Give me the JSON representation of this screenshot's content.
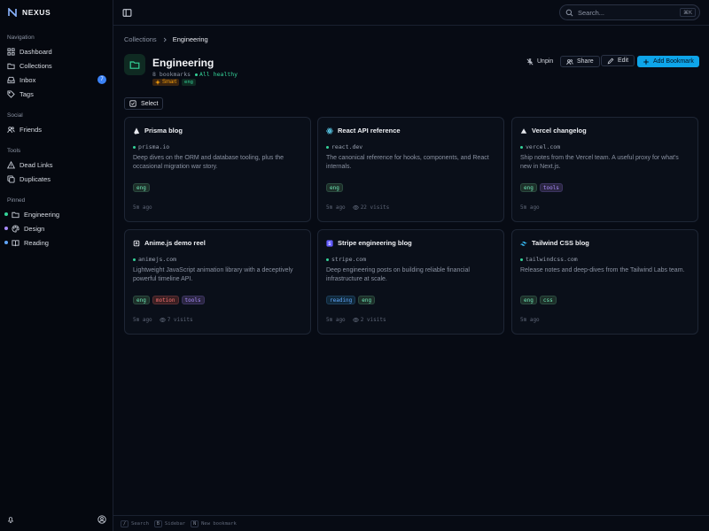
{
  "brand": {
    "name": "NEXUS"
  },
  "sidebar": {
    "sections": [
      {
        "label": "Navigation"
      },
      {
        "label": "Social"
      },
      {
        "label": "Tools"
      },
      {
        "label": "Pinned"
      }
    ],
    "navigation": [
      {
        "label": "Dashboard",
        "icon": "grid-icon"
      },
      {
        "label": "Collections",
        "icon": "folder-icon"
      },
      {
        "label": "Inbox",
        "icon": "inbox-icon",
        "badge": "7"
      },
      {
        "label": "Tags",
        "icon": "tag-icon"
      }
    ],
    "social": [
      {
        "label": "Friends",
        "icon": "users-icon"
      }
    ],
    "tools": [
      {
        "label": "Dead Links",
        "icon": "warning-icon"
      },
      {
        "label": "Duplicates",
        "icon": "copy-icon"
      }
    ],
    "pinned": [
      {
        "label": "Engineering",
        "icon": "folder-icon",
        "dot_color": "#34d399"
      },
      {
        "label": "Design",
        "icon": "palette-icon",
        "dot_color": "#a78bfa"
      },
      {
        "label": "Reading",
        "icon": "book-icon",
        "dot_color": "#60a5fa"
      }
    ]
  },
  "topbar": {
    "search_placeholder": "Search...",
    "search_shortcut": "⌘K"
  },
  "breadcrumb": {
    "parent": "Collections",
    "current": "Engineering"
  },
  "collection": {
    "title": "Engineering",
    "count": "8 bookmarks",
    "health": "All healthy",
    "smart_chip": "Smart",
    "tag_chip": "eng"
  },
  "actions": {
    "unpin": "Unpin",
    "share": "Share",
    "edit": "Edit",
    "add": "Add Bookmark"
  },
  "select_label": "Select",
  "cards": [
    {
      "title": "Prisma blog",
      "icon": "prisma-icon",
      "domain": "prisma.io",
      "desc": "Deep dives on the ORM and database tooling, plus the occasional migration war story.",
      "tags": [
        "eng"
      ],
      "time": "5m ago",
      "visits": ""
    },
    {
      "title": "React API reference",
      "icon": "react-icon",
      "domain": "react.dev",
      "desc": "The canonical reference for hooks, components, and React internals.",
      "tags": [
        "eng"
      ],
      "time": "5m ago",
      "visits": "22 visits"
    },
    {
      "title": "Vercel changelog",
      "icon": "vercel-icon",
      "domain": "vercel.com",
      "desc": "Ship notes from the Vercel team. A useful proxy for what's new in Next.js.",
      "tags": [
        "eng",
        "tools"
      ],
      "time": "5m ago",
      "visits": ""
    },
    {
      "title": "Anime.js demo reel",
      "icon": "anime-icon",
      "domain": "animejs.com",
      "desc": "Lightweight JavaScript animation library with a deceptively powerful timeline API.",
      "tags": [
        "eng",
        "motion",
        "tools"
      ],
      "time": "5m ago",
      "visits": "7 visits"
    },
    {
      "title": "Stripe engineering blog",
      "icon": "stripe-icon",
      "domain": "stripe.com",
      "desc": "Deep engineering posts on building reliable financial infrastructure at scale.",
      "tags": [
        "reading",
        "eng"
      ],
      "time": "5m ago",
      "visits": "2 visits"
    },
    {
      "title": "Tailwind CSS blog",
      "icon": "tailwind-icon",
      "domain": "tailwindcss.com",
      "desc": "Release notes and deep-dives from the Tailwind Labs team.",
      "tags": [
        "eng",
        "css"
      ],
      "time": "5m ago",
      "visits": ""
    }
  ],
  "statusbar": {
    "items": [
      {
        "key": "/",
        "label": "Search"
      },
      {
        "key": "B",
        "label": "Sidebar"
      },
      {
        "key": "N",
        "label": "New bookmark"
      }
    ]
  }
}
